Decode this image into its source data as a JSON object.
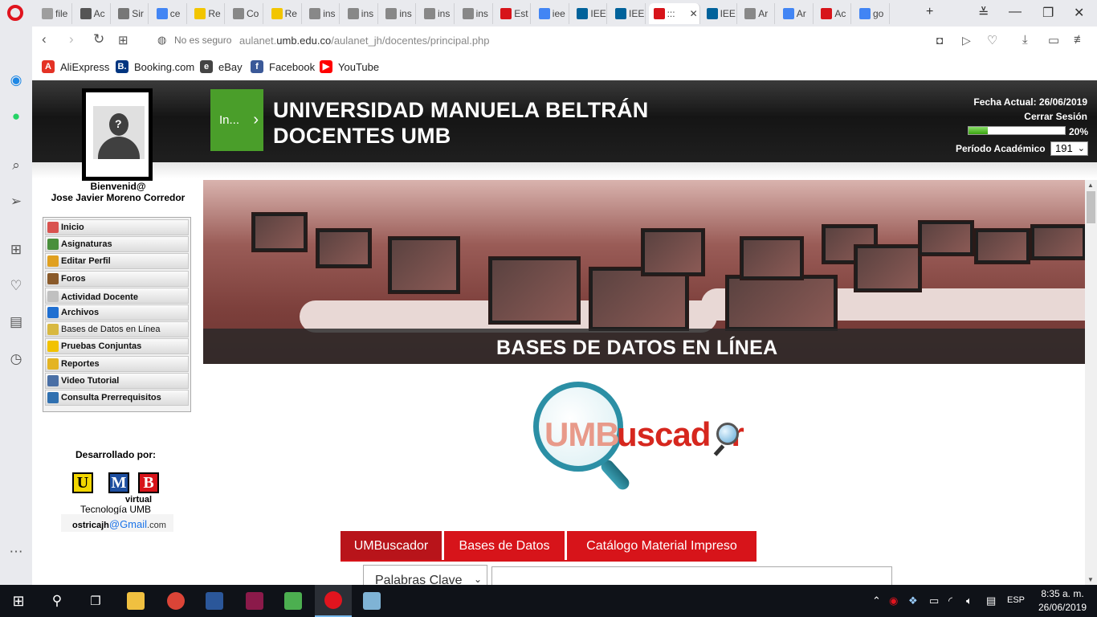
{
  "browser": {
    "tabs": [
      {
        "label": "file",
        "color": "#9e9e9e"
      },
      {
        "label": "Ac",
        "color": "#555555"
      },
      {
        "label": "Sir",
        "color": "#777777"
      },
      {
        "label": "ce",
        "color": "#4285f4"
      },
      {
        "label": "Re",
        "color": "#f2c500"
      },
      {
        "label": "Co",
        "color": "#888888"
      },
      {
        "label": "Re",
        "color": "#f2c500"
      },
      {
        "label": "ins",
        "color": "#888888"
      },
      {
        "label": "ins",
        "color": "#888888"
      },
      {
        "label": "ins",
        "color": "#888888"
      },
      {
        "label": "ins",
        "color": "#888888"
      },
      {
        "label": "ins",
        "color": "#888888"
      },
      {
        "label": "Est",
        "color": "#d7141a"
      },
      {
        "label": "iee",
        "color": "#4285f4"
      },
      {
        "label": "IEE",
        "color": "#00629b"
      },
      {
        "label": "IEE",
        "color": "#00629b"
      },
      {
        "label": ":::",
        "color": "#d7141a"
      },
      {
        "label": "IEE",
        "color": "#00629b"
      },
      {
        "label": "Ar",
        "color": "#888888"
      },
      {
        "label": "Ar",
        "color": "#4285f4"
      },
      {
        "label": "Ac",
        "color": "#d7141a"
      },
      {
        "label": "go",
        "color": "#4285f4"
      }
    ],
    "active_tab_index": 16,
    "address": {
      "security": "No es seguro",
      "url_prefix": "aulanet.",
      "url_domain": "umb.edu.co",
      "url_path": "/aulanet_jh/docentes/principal.php"
    },
    "bookmarks": [
      {
        "label": "AliExpress",
        "icon": "aliexpress-icon",
        "color": "#e43225",
        "glyph": "A"
      },
      {
        "label": "Booking.com",
        "icon": "booking-icon",
        "color": "#003580",
        "glyph": "B."
      },
      {
        "label": "eBay",
        "icon": "ebay-icon",
        "color": "#444444",
        "glyph": "e"
      },
      {
        "label": "Facebook",
        "icon": "facebook-icon",
        "color": "#3b5998",
        "glyph": "f"
      },
      {
        "label": "YouTube",
        "icon": "youtube-icon",
        "color": "#ff0000",
        "glyph": "▶"
      }
    ]
  },
  "header": {
    "start_button": "In...",
    "title_line1": "UNIVERSIDAD MANUELA BELTRÁN",
    "title_line2": "DOCENTES UMB",
    "fecha": "Fecha Actual: 26/06/2019",
    "logout": "Cerrar Sesión",
    "progress_percent": 20,
    "progress_label": "20%",
    "periodo_label": "Período Académico",
    "periodo_value": "191"
  },
  "user": {
    "welcome": "Bienvenid@",
    "name": "Jose Javier Moreno Corredor"
  },
  "menu": [
    {
      "label": "Inicio",
      "icon": "home-icon",
      "color": "#d9534f"
    },
    {
      "label": "Asignaturas",
      "icon": "books-icon",
      "color": "#4a8f3c"
    },
    {
      "label": "Editar Perfil",
      "icon": "pencil-icon",
      "color": "#e0a020"
    },
    {
      "label": "Foros",
      "icon": "forum-icon",
      "color": "#8a5a2a"
    },
    {
      "label": "Actividad Docente",
      "icon": "calendar-icon",
      "color": "#c0c0c0"
    },
    {
      "label": "Archivos",
      "icon": "folder-icon",
      "color": "#1f6fd1"
    },
    {
      "label": "Bases de Datos en Línea",
      "icon": "database-icon",
      "color": "#d8b840"
    },
    {
      "label": "Pruebas Conjuntas",
      "icon": "document-icon",
      "color": "#f2c200"
    },
    {
      "label": "Reportes",
      "icon": "report-icon",
      "color": "#e4b423"
    },
    {
      "label": "Video Tutorial",
      "icon": "video-icon",
      "color": "#4a6fa5"
    },
    {
      "label": "Consulta Prerrequisitos",
      "icon": "search-icon",
      "color": "#3070b0"
    }
  ],
  "footer_left": {
    "developed_by": "Desarrollado por:",
    "logo_letters": [
      "U",
      "M",
      "B"
    ],
    "logo_colors": [
      "#f2d600",
      "#1e4fa0",
      "#d7141a"
    ],
    "logo_sub": "virtual",
    "tech": "Tecnología UMB",
    "email_user": "ostricajh",
    "email_at": "@",
    "email_domain": "Gmail",
    "email_tld": ".com"
  },
  "banner": {
    "text": "BASES DE DATOS EN LÍNEA"
  },
  "search_logo": {
    "part1": "UMB",
    "part2": "uscad",
    "part3": "r"
  },
  "search_tabs": [
    {
      "label": "UMBuscador",
      "active": true
    },
    {
      "label": "Bases de Datos",
      "active": false
    },
    {
      "label": "Catálogo Material Impreso",
      "active": false
    }
  ],
  "search": {
    "select_value": "Palabras Clave",
    "input_value": ""
  },
  "taskbar": {
    "apps": [
      {
        "name": "file-explorer",
        "color": "#f0c040"
      },
      {
        "name": "chrome",
        "color": "#db4437"
      },
      {
        "name": "word",
        "color": "#2b579a"
      },
      {
        "name": "winrar",
        "color": "#8b1a4a"
      },
      {
        "name": "excel-tool",
        "color": "#4caf50"
      },
      {
        "name": "opera",
        "color": "#e0141e"
      },
      {
        "name": "notepad",
        "color": "#7fb3d5"
      }
    ],
    "language": "ESP",
    "time": "8:35 a. m.",
    "date": "26/06/2019"
  }
}
